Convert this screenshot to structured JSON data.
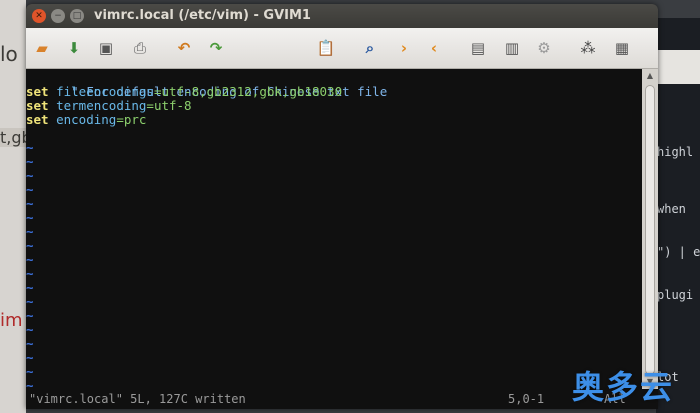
{
  "window": {
    "title": "vimrc.local (/etc/vim) - GVIM1"
  },
  "toolbar": {
    "icons": [
      "open-folder-icon",
      "save-download-icon",
      "save-icon",
      "print-icon",
      "undo-icon",
      "redo-icon",
      "paste-icon",
      "find-replace-icon",
      "find-next-icon",
      "find-prev-icon",
      "load-session-icon",
      "save-session-icon",
      "run-script-icon",
      "make-icon",
      "tags-icon"
    ]
  },
  "editor": {
    "lines": [
      {
        "type": "comment",
        "text": "\" For default encoding of Chinese txt file"
      },
      {
        "type": "set",
        "keyword": "set",
        "option": "fileencodings",
        "eq": "=",
        "value": "utf-8,gb2312,gbk,gb18030"
      },
      {
        "type": "set",
        "keyword": "set",
        "option": "termencoding",
        "eq": "=",
        "value": "utf-8"
      },
      {
        "type": "set",
        "keyword": "set",
        "option": "encoding",
        "eq": "=",
        "value": "prc"
      }
    ],
    "tilde": "~"
  },
  "status": {
    "message": "\"vimrc.local\" 5L, 127C written",
    "position": "5,0-1",
    "scroll": "All"
  },
  "background": {
    "left_lines": [
      "lo",
      "t,gb",
      "im"
    ],
    "right_lines": [
      "highl",
      "when",
      "\") | e",
      " plugi",
      "lot"
    ]
  },
  "watermark": "奥多云"
}
